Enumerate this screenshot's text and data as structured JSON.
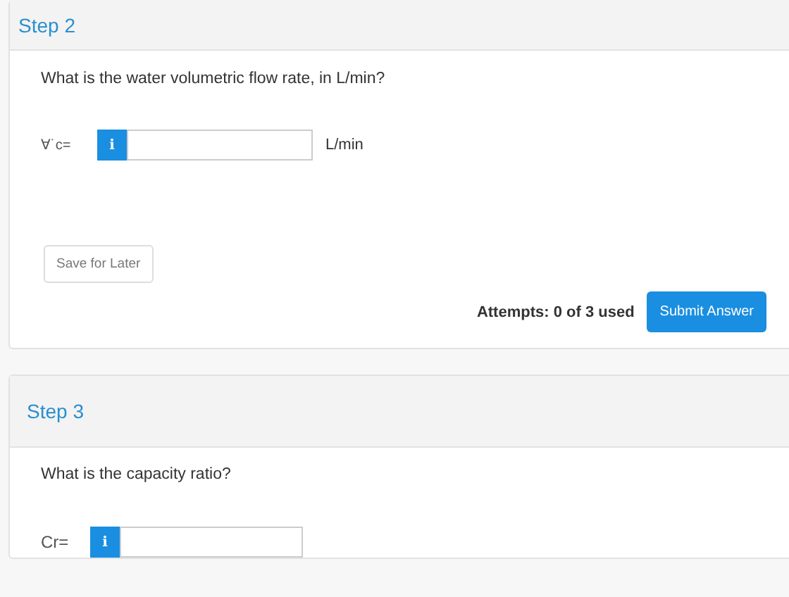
{
  "steps": [
    {
      "title": "Step 2",
      "question": "What is the water volumetric flow rate, in L/min?",
      "field": {
        "label": "∀˙c=",
        "info": "i",
        "unit": "L/min"
      },
      "save_button": "Save for Later",
      "attempts": "Attempts: 0 of 3 used",
      "submit_button": "Submit Answer"
    },
    {
      "title": "Step 3",
      "question": "What is the capacity ratio?",
      "field": {
        "label": "Cr=",
        "info": "i"
      }
    }
  ]
}
